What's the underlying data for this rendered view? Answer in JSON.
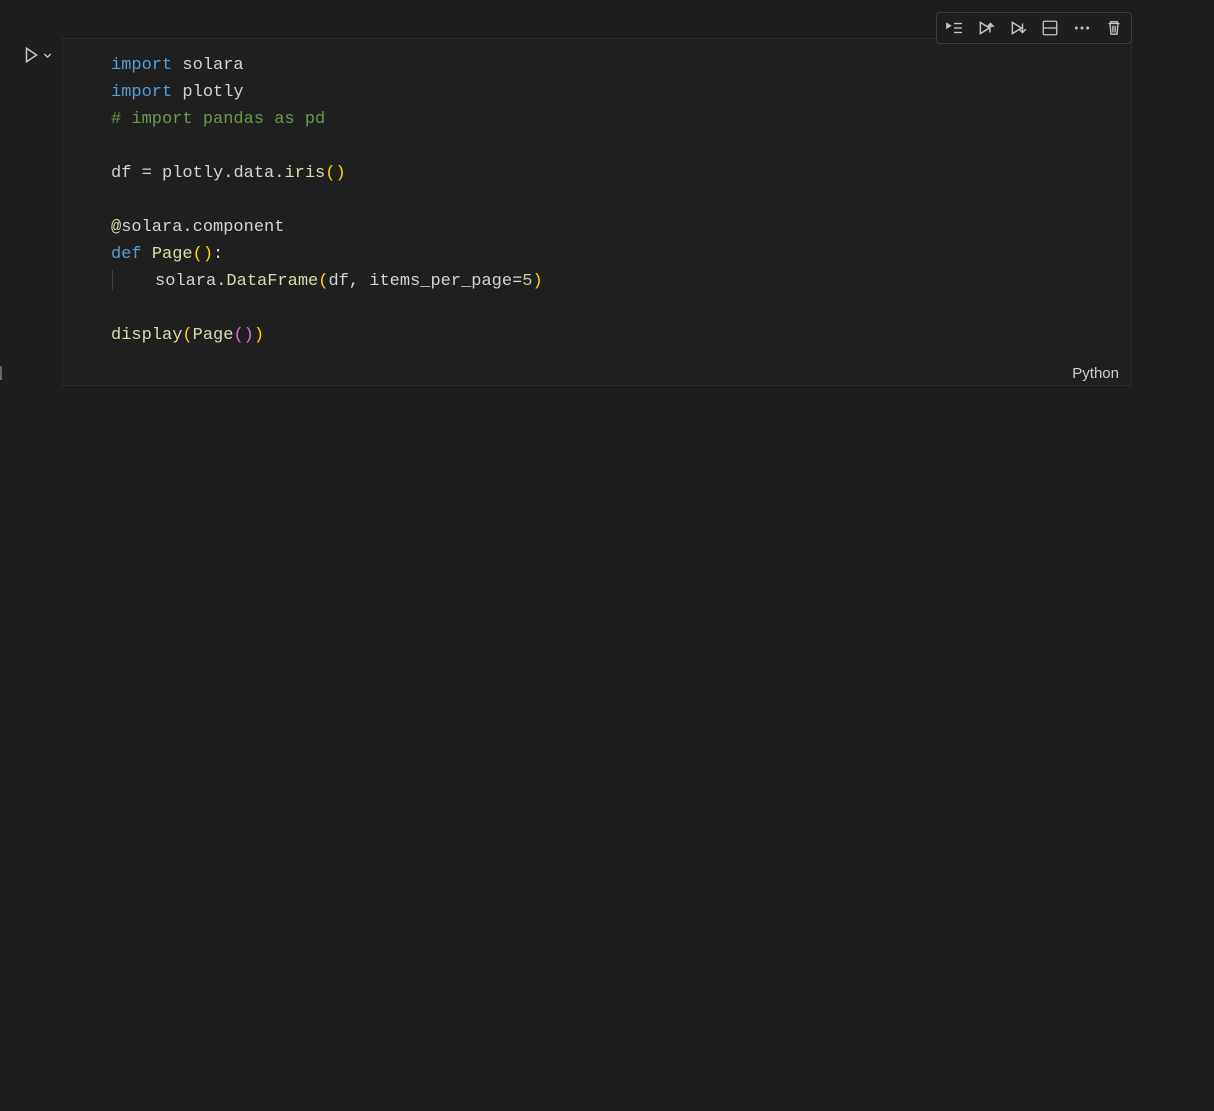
{
  "toolbar": {
    "run_by_line": "Run by Line",
    "execute_above": "Execute Above Cells",
    "execute_below": "Execute Cell and Below",
    "split_cell": "Split Cell",
    "more": "More Actions",
    "delete": "Delete Cell"
  },
  "cell": {
    "execution_count": "[ ]",
    "language": "Python",
    "code": {
      "l1_kw": "import",
      "l1_mod": "solara",
      "l2_kw": "import",
      "l2_mod": "plotly",
      "l3_comment": "# import pandas as pd",
      "l5_lhs": "df",
      "l5_eq": " = ",
      "l5_mod1": "plotly",
      "l5_dot1": ".",
      "l5_mod2": "data",
      "l5_dot2": ".",
      "l5_fn": "iris",
      "l5_open": "(",
      "l5_close": ")",
      "l7_at": "@",
      "l7_dec_mod": "solara",
      "l7_dec_dot": ".",
      "l7_dec_fn": "component",
      "l8_def": "def",
      "l8_name": "Page",
      "l8_open": "(",
      "l8_close": ")",
      "l8_colon": ":",
      "l9_mod": "solara",
      "l9_dot": ".",
      "l9_fn": "DataFrame",
      "l9_open": "(",
      "l9_arg1": "df",
      "l9_comma": ", ",
      "l9_kw": "items_per_page",
      "l9_eq": "=",
      "l9_val": "5",
      "l9_close": ")",
      "l11_fn": "display",
      "l11_open": "(",
      "l11_call": "Page",
      "l11_in_open": "(",
      "l11_in_close": ")",
      "l11_close": ")"
    }
  }
}
